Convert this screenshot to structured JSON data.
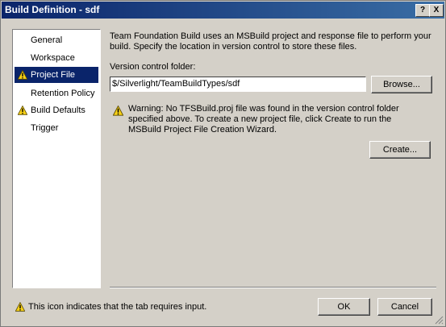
{
  "window": {
    "title": "Build Definition - sdf",
    "help_label": "?",
    "close_label": "X"
  },
  "sidebar": {
    "items": [
      {
        "label": "General",
        "warning": false,
        "selected": false
      },
      {
        "label": "Workspace",
        "warning": false,
        "selected": false
      },
      {
        "label": "Project File",
        "warning": true,
        "selected": true
      },
      {
        "label": "Retention Policy",
        "warning": false,
        "selected": false
      },
      {
        "label": "Build Defaults",
        "warning": true,
        "selected": false
      },
      {
        "label": "Trigger",
        "warning": false,
        "selected": false
      }
    ]
  },
  "main": {
    "description": "Team Foundation Build uses an MSBuild project and response file to perform your build. Specify the location in version control to store these files.",
    "folder_label": "Version control folder:",
    "folder_value": "$/Silverlight/TeamBuildTypes/sdf",
    "browse_label": "Browse...",
    "warning_text": "Warning: No TFSBuild.proj file was found in the version control folder specified above. To create a new project file, click Create to run the MSBuild Project File Creation Wizard.",
    "create_label": "Create..."
  },
  "footer": {
    "note": "This icon indicates that the tab requires input.",
    "ok_label": "OK",
    "cancel_label": "Cancel"
  },
  "colors": {
    "titlebar": "#0a246a",
    "selection": "#0a246a",
    "warning_yellow": "#f7d117"
  }
}
